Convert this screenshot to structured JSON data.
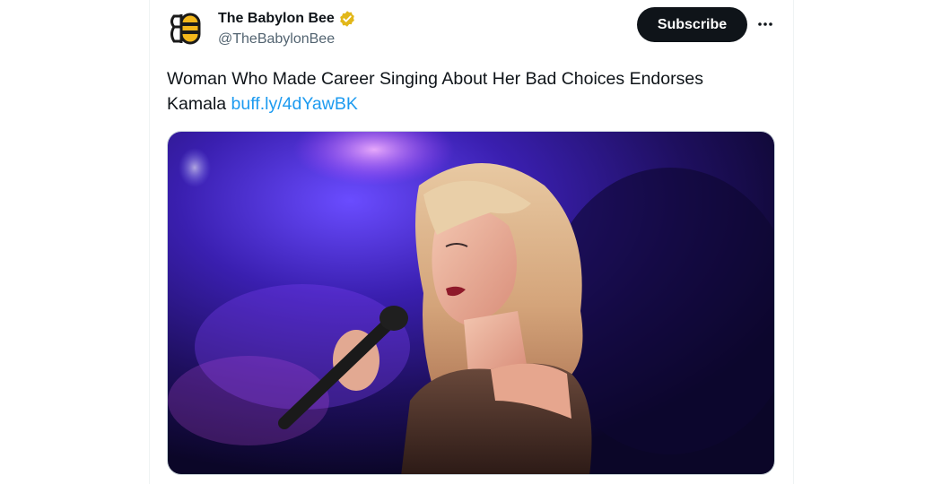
{
  "tweet": {
    "author": {
      "name": "The Babylon Bee",
      "handle": "@TheBabylonBee",
      "verified": true,
      "verified_color": "#e2b719",
      "avatar_icon": "bee-logo-icon"
    },
    "subscribe_label": "Subscribe",
    "more_icon": "more-horizontal-icon",
    "text": "Woman Who Made Career Singing About Her Bad Choices Endorses Kamala",
    "link_text": "buff.ly/4dYawBK",
    "media": {
      "type": "photo"
    }
  },
  "colors": {
    "text_primary": "#0f1419",
    "text_secondary": "#536471",
    "link": "#1d9bf0",
    "button_bg": "#0f1419"
  }
}
